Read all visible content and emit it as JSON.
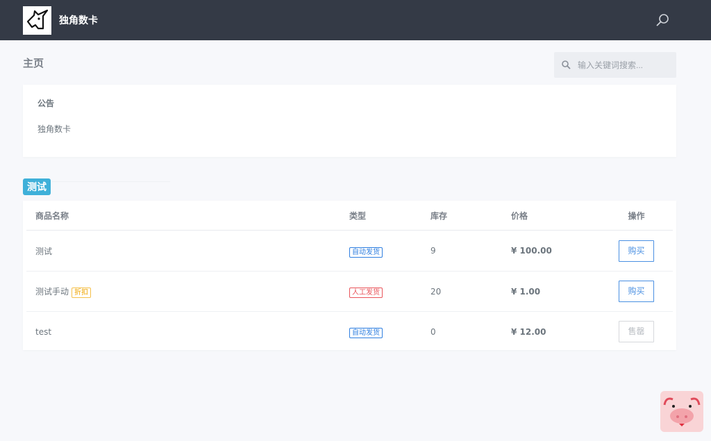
{
  "nav": {
    "brand": "独角数卡"
  },
  "page": {
    "title": "主页",
    "search_placeholder": "输入关键词搜索..."
  },
  "notice": {
    "heading": "公告",
    "body": "独角数卡"
  },
  "category": {
    "name": "测试"
  },
  "table": {
    "headers": [
      "商品名称",
      "类型",
      "库存",
      "价格",
      "操作"
    ],
    "rows": [
      {
        "name": "测试",
        "tag": "",
        "type": "自动发货",
        "stock": "9",
        "price": "¥ 100.00",
        "action": "购买"
      },
      {
        "name": "测试手动",
        "tag": "折扣",
        "type": "人工发货",
        "stock": "20",
        "price": "¥ 1.00",
        "action": "购买"
      },
      {
        "name": "test",
        "tag": "",
        "type": "自动发货",
        "stock": "0",
        "price": "¥ 12.00",
        "action": "售罄"
      }
    ]
  },
  "colors": {
    "nav": "#343a46",
    "accent": "#3fb0d9",
    "auto": "#2f7fe0",
    "manual": "#e9545a"
  }
}
